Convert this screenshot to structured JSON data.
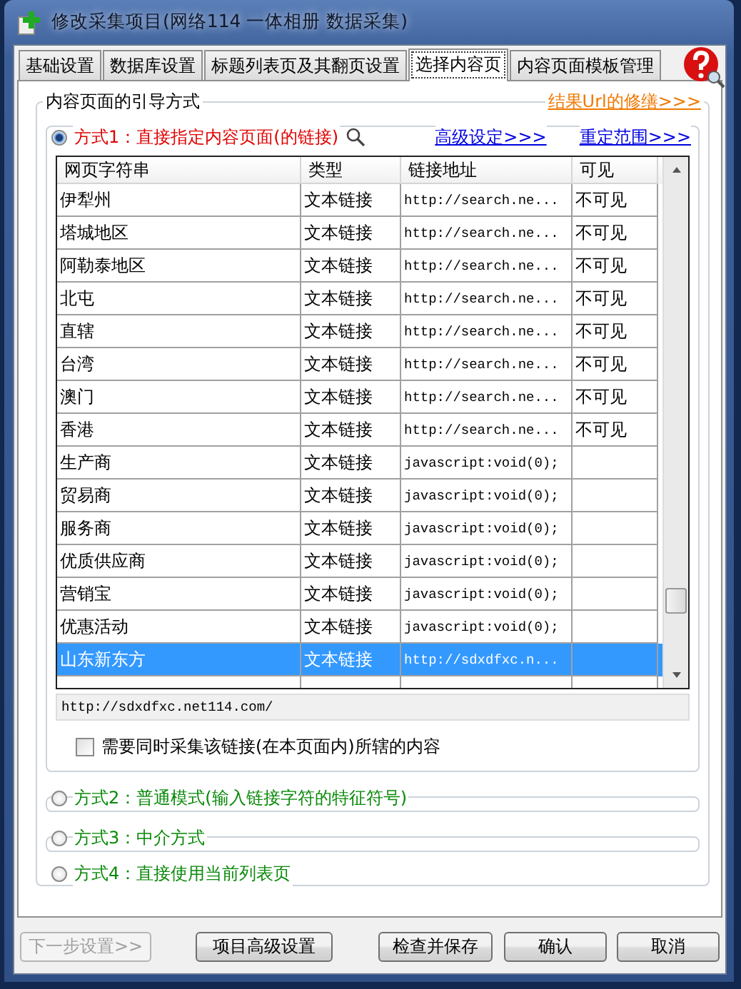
{
  "window": {
    "title": "修改采集项目(网络114 一体相册 数据采集)"
  },
  "tabs": [
    {
      "label": "基础设置",
      "selected": false
    },
    {
      "label": "数据库设置",
      "selected": false
    },
    {
      "label": "标题列表页及其翻页设置",
      "selected": false
    },
    {
      "label": "选择内容页",
      "selected": true
    },
    {
      "label": "内容页面模板管理",
      "selected": false
    }
  ],
  "group": {
    "title": "内容页面的引导方式",
    "link": "结果Url的修缮>>>"
  },
  "methods": [
    {
      "label": "方式1：直接指定内容页面(的链接)",
      "selected": true,
      "kind": "panel",
      "links": [
        "高级设定>>>",
        "重定范围>>>"
      ]
    },
    {
      "label": "方式2：普通模式(输入链接字符的特征符号)",
      "selected": false,
      "kind": "collapsed"
    },
    {
      "label": "方式3：中介方式",
      "selected": false,
      "kind": "collapsed"
    },
    {
      "label": "方式4：直接使用当前列表页",
      "selected": false,
      "kind": "plain"
    }
  ],
  "table": {
    "columns": [
      "网页字符串",
      "类型",
      "链接地址",
      "可见"
    ],
    "rows": [
      {
        "name": "伊犁州",
        "type": "文本链接",
        "url": "http://search.ne...",
        "visible": "不可见",
        "selected": false
      },
      {
        "name": "塔城地区",
        "type": "文本链接",
        "url": "http://search.ne...",
        "visible": "不可见",
        "selected": false
      },
      {
        "name": "阿勒泰地区",
        "type": "文本链接",
        "url": "http://search.ne...",
        "visible": "不可见",
        "selected": false
      },
      {
        "name": "北屯",
        "type": "文本链接",
        "url": "http://search.ne...",
        "visible": "不可见",
        "selected": false
      },
      {
        "name": "直辖",
        "type": "文本链接",
        "url": "http://search.ne...",
        "visible": "不可见",
        "selected": false
      },
      {
        "name": "台湾",
        "type": "文本链接",
        "url": "http://search.ne...",
        "visible": "不可见",
        "selected": false
      },
      {
        "name": "澳门",
        "type": "文本链接",
        "url": "http://search.ne...",
        "visible": "不可见",
        "selected": false
      },
      {
        "name": "香港",
        "type": "文本链接",
        "url": "http://search.ne...",
        "visible": "不可见",
        "selected": false
      },
      {
        "name": "生产商",
        "type": "文本链接",
        "url": "javascript:void(0);",
        "selected": false
      },
      {
        "name": "贸易商",
        "type": "文本链接",
        "url": "javascript:void(0);",
        "selected": false
      },
      {
        "name": "服务商",
        "type": "文本链接",
        "url": "javascript:void(0);",
        "selected": false
      },
      {
        "name": "优质供应商",
        "type": "文本链接",
        "url": "javascript:void(0);",
        "selected": false
      },
      {
        "name": "营销宝",
        "type": "文本链接",
        "url": "javascript:void(0);",
        "selected": false
      },
      {
        "name": "优惠活动",
        "type": "文本链接",
        "url": "javascript:void(0);",
        "selected": false
      },
      {
        "name": "山东新东方",
        "type": "文本链接",
        "url": "http://sdxdfxc.n...",
        "selected": true
      }
    ]
  },
  "url_field": {
    "value": "http://sdxdfxc.net114.com/"
  },
  "checkbox": {
    "label": "需要同时采集该链接(在本页面内)所辖的内容",
    "checked": false
  },
  "buttons": [
    {
      "label": "下一步设置>>",
      "disabled": true
    },
    {
      "label": "项目高级设置",
      "disabled": false
    },
    {
      "label": "检查并保存",
      "disabled": false
    },
    {
      "label": "确认",
      "disabled": false
    },
    {
      "label": "取消",
      "disabled": false
    }
  ]
}
